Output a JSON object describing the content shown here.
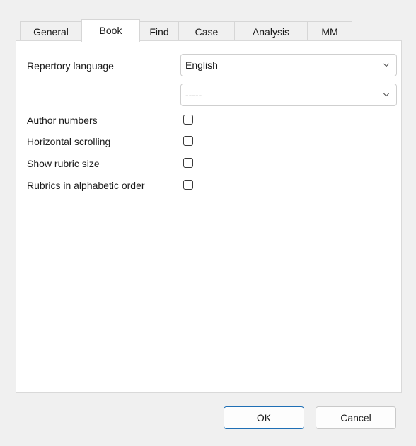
{
  "tabs": [
    {
      "label": "General"
    },
    {
      "label": "Book"
    },
    {
      "label": "Find"
    },
    {
      "label": "Case"
    },
    {
      "label": "Analysis"
    },
    {
      "label": "MM"
    }
  ],
  "active_tab": "Book",
  "form": {
    "repertory_language_label": "Repertory language",
    "repertory_language_value": "English",
    "secondary_select_value": "-----",
    "options": [
      {
        "label": "Author numbers",
        "checked": false
      },
      {
        "label": "Horizontal scrolling",
        "checked": false
      },
      {
        "label": "Show rubric size",
        "checked": false
      },
      {
        "label": "Rubrics in alphabetic order",
        "checked": false
      }
    ]
  },
  "buttons": {
    "ok": "OK",
    "cancel": "Cancel"
  },
  "colors": {
    "ok_border": "#1f6fb5",
    "background": "#f0f0f0",
    "panel": "#ffffff"
  }
}
